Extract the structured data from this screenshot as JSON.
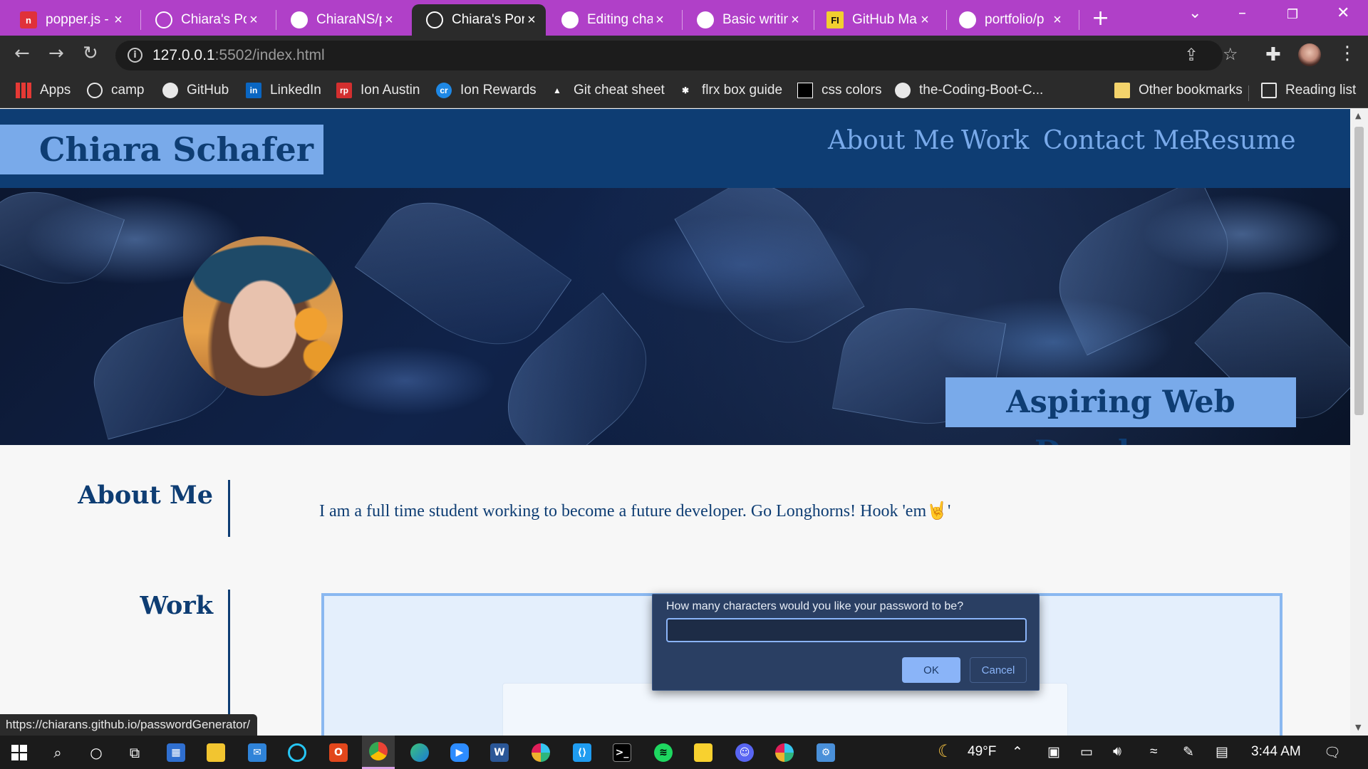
{
  "browser": {
    "tabs": [
      {
        "title": "popper.js - ",
        "icon": "popper-icon",
        "active": false
      },
      {
        "title": "Chiara's Por",
        "icon": "globe-icon",
        "active": false
      },
      {
        "title": "ChiaraNS/p",
        "icon": "github-icon",
        "active": false
      },
      {
        "title": "Chiara's Por",
        "icon": "globe-icon",
        "active": true
      },
      {
        "title": "Editing cha",
        "icon": "github-icon",
        "active": false
      },
      {
        "title": "Basic writin",
        "icon": "github-icon",
        "active": false
      },
      {
        "title": "GitHub Ma",
        "icon": "fi-icon",
        "active": false
      },
      {
        "title": "portfolio/p",
        "icon": "github-icon",
        "active": false
      }
    ],
    "address": {
      "host": "127.0.0.1",
      "path": ":5502/index.html"
    },
    "bookmarks": [
      {
        "label": "Apps",
        "icon": "apps-icon"
      },
      {
        "label": "camp",
        "icon": "globe-icon"
      },
      {
        "label": "GitHub",
        "icon": "github-icon"
      },
      {
        "label": "LinkedIn",
        "icon": "linkedin-icon"
      },
      {
        "label": "Ion Austin",
        "icon": "rp-icon"
      },
      {
        "label": "Ion Rewards",
        "icon": "cr-icon"
      },
      {
        "label": "Git cheat sheet",
        "icon": "atlassian-icon"
      },
      {
        "label": "flrx box guide",
        "icon": "asterisk-icon"
      },
      {
        "label": "css colors",
        "icon": "css-icon"
      },
      {
        "label": "the-Coding-Boot-C...",
        "icon": "github-icon"
      }
    ],
    "other_bookmarks": "Other bookmarks",
    "reading_list": "Reading list",
    "status_url": "https://chiarans.github.io/passwordGenerator/"
  },
  "site": {
    "name": "Chiara Schafer",
    "nav": [
      "About Me",
      "Work",
      "Contact Me",
      "Resume"
    ],
    "tagline": "Aspiring Web Developer",
    "about_title": "About Me",
    "about_text": "I am a full time student working to become a future developer. Go Longhorns! Hook 'em",
    "about_text_after": "'",
    "hand_emoji": "🤘",
    "work_title": "Work"
  },
  "dialog": {
    "message": "How many characters would you like your password to be?",
    "value": "",
    "ok": "OK",
    "cancel": "Cancel"
  },
  "taskbar": {
    "weather": "49°F",
    "time": "3:44 AM"
  },
  "colors": {
    "tab_bar": "#b040c8",
    "site_navy": "#0e3d73",
    "site_accent": "#79aaea",
    "dialog_bg": "#2a3f63",
    "dialog_button": "#8ab4f8"
  }
}
